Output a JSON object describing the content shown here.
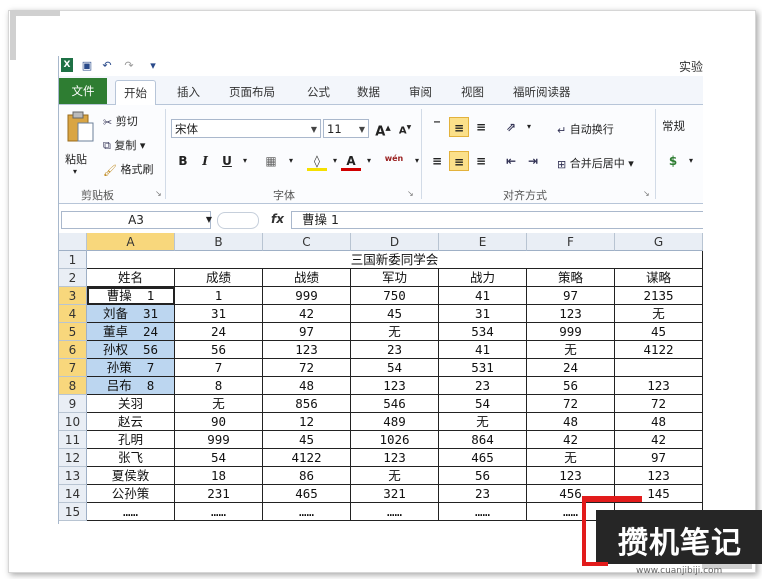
{
  "app": {
    "title_partial": "实验",
    "logo": "X"
  },
  "tabs": [
    "文件",
    "开始",
    "插入",
    "页面布局",
    "公式",
    "数据",
    "审阅",
    "视图",
    "福昕阅读器"
  ],
  "ribbon": {
    "clipboard": {
      "paste": "粘贴",
      "cut": "剪切",
      "copy": "复制",
      "format_painter": "格式刷",
      "label": "剪贴板"
    },
    "font": {
      "name": "宋体",
      "size": "11",
      "bold": "B",
      "italic": "I",
      "underline": "U",
      "label": "字体",
      "wen": "wén"
    },
    "alignment": {
      "wrap": "自动换行",
      "merge": "合并后居中",
      "label": "对齐方式"
    },
    "number": {
      "format": "常规"
    }
  },
  "formula_bar": {
    "name_box": "A3",
    "fx": "fx",
    "content": "曹操  1"
  },
  "columns": [
    "A",
    "B",
    "C",
    "D",
    "E",
    "F",
    "G"
  ],
  "rows": [
    [
      "三国新委同学会"
    ],
    [
      "姓名",
      "成绩",
      "战绩",
      "军功",
      "战力",
      "策略",
      "谋略"
    ],
    [
      "曹操  1",
      "1",
      "999",
      "750",
      "41",
      "97",
      "2135"
    ],
    [
      "刘备  31",
      "31",
      "42",
      "45",
      "31",
      "123",
      "无"
    ],
    [
      "董卓  24",
      "24",
      "97",
      "无",
      "534",
      "999",
      "45"
    ],
    [
      "孙权  56",
      "56",
      "123",
      "23",
      "41",
      "无",
      "4122"
    ],
    [
      "孙策  7",
      "7",
      "72",
      "54",
      "531",
      "24",
      ""
    ],
    [
      "吕布  8",
      "8",
      "48",
      "123",
      "23",
      "56",
      "123"
    ],
    [
      "关羽",
      "无",
      "856",
      "546",
      "54",
      "72",
      "72"
    ],
    [
      "赵云",
      "90",
      "12",
      "489",
      "无",
      "48",
      "48"
    ],
    [
      "孔明",
      "999",
      "45",
      "1026",
      "864",
      "42",
      "42"
    ],
    [
      "张飞",
      "54",
      "4122",
      "123",
      "465",
      "无",
      "97"
    ],
    [
      "夏侯敦",
      "18",
      "86",
      "无",
      "56",
      "123",
      "123"
    ],
    [
      "公孙策",
      "231",
      "465",
      "321",
      "23",
      "456",
      "145"
    ],
    [
      "……",
      "……",
      "……",
      "……",
      "……",
      "……",
      ""
    ]
  ],
  "watermark": {
    "text": "攒机笔记",
    "url": "www.cuanjibiji.com"
  }
}
